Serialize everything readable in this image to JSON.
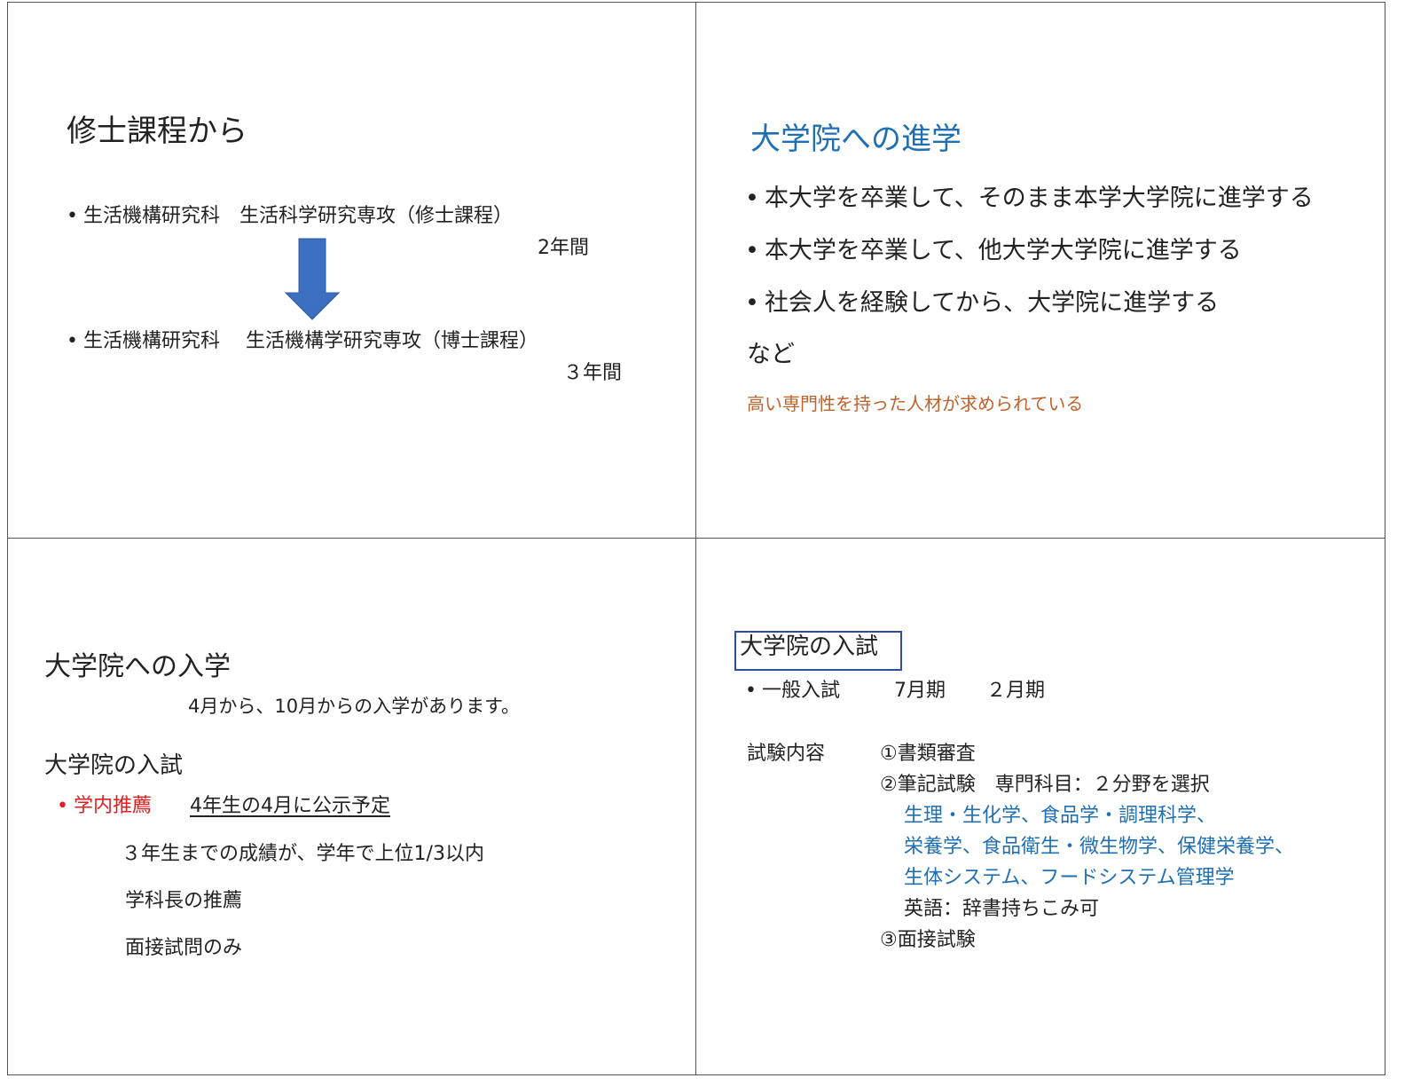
{
  "slide1": {
    "title": "修士課程から",
    "item1": "生活機構研究科　生活科学研究専攻（修士課程）",
    "item1_duration": "2年間",
    "item2": "生活機構研究科　 生活機構学研究専攻（博士課程）",
    "item2_duration": "３年間",
    "arrow_color": "#3b6fc0"
  },
  "slide2": {
    "title": "大学院への進学",
    "bullets": [
      "本大学を卒業して、そのまま本学大学院に進学する",
      "本大学を卒業して、他大学大学院に進学する",
      "社会人を経験してから、大学院に進学する"
    ],
    "etc": "など",
    "note": "高い専門性を持った人材が求められている"
  },
  "slide3": {
    "title": "大学院への入学",
    "intake": "4月から、10月からの入学があります。",
    "exam_heading": "大学院の入試",
    "recommend_label": "学内推薦",
    "recommend_note": "4年生の4月に公示予定",
    "requirements": [
      "３年生までの成績が、学年で上位1/3以内",
      "学科長の推薦",
      "面接試問のみ"
    ]
  },
  "slide4": {
    "title": "大学院の入試",
    "general_exam": "一般入試",
    "term1": "7月期",
    "term2": "２月期",
    "content_label": "試験内容",
    "step1": "①書類審査",
    "step2": "②筆記試験　専門科目：２分野を選択",
    "fields": [
      "生理・生化学、食品学・調理科学、",
      "栄養学、食品衛生・微生物学、保健栄養学、",
      "生体システム、フードシステム管理学"
    ],
    "english": "英語：辞書持ちこみ可",
    "step3": "③面接試験"
  }
}
